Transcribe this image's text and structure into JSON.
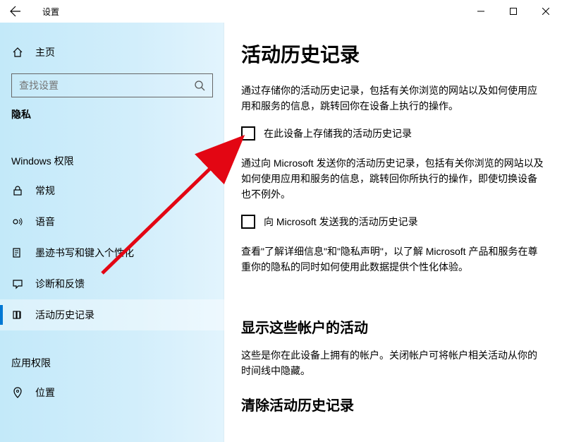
{
  "titlebar": {
    "app_title": "设置"
  },
  "sidebar": {
    "home_label": "主页",
    "search_placeholder": "查找设置",
    "privacy_label": "隐私",
    "win_perm_label": "Windows 权限",
    "app_perm_label": "应用权限",
    "items": {
      "general": "常规",
      "speech": "语音",
      "inking": "墨迹书写和键入个性化",
      "diagnostics": "诊断和反馈",
      "activity": "活动历史记录",
      "location": "位置"
    }
  },
  "main": {
    "title": "活动历史记录",
    "p1": "通过存储你的活动历史记录，包括有关你浏览的网站以及如何使用应用和服务的信息，跳转回你在设备上执行的操作。",
    "chk1": "在此设备上存储我的活动历史记录",
    "p2": "通过向 Microsoft 发送你的活动历史记录，包括有关你浏览的网站以及如何使用应用和服务的信息，跳转回你所执行的操作，即使切换设备也不例外。",
    "chk2": "向 Microsoft 发送我的活动历史记录",
    "p3": "查看\"了解详细信息\"和\"隐私声明\"，以了解 Microsoft 产品和服务在尊重你的隐私的同时如何使用此数据提供个性化体验。",
    "h2": "显示这些帐户的活动",
    "p4": "这些是你在此设备上拥有的帐户。关闭帐户可将帐户相关活动从你的时间线中隐藏。",
    "h3": "清除活动历史记录"
  }
}
